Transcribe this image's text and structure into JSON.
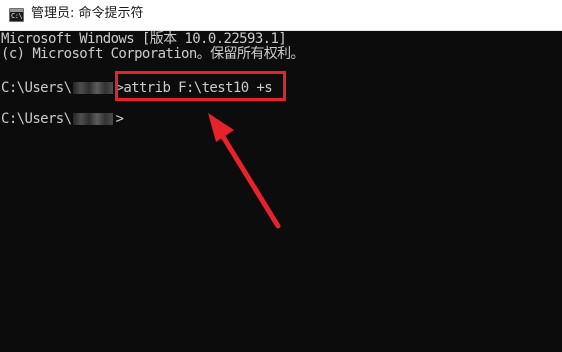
{
  "window": {
    "title": "管理员: 命令提示符",
    "icon": "cmd-icon",
    "icon_glyph": "C:\\"
  },
  "console": {
    "line1": "Microsoft Windows [版本 10.0.22593.1]",
    "line2": "(c) Microsoft Corporation。保留所有权利。",
    "prompt_prefix": "C:\\Users\\",
    "prompt_suffix": ">",
    "command": "attrib F:\\test10 +s",
    "prompt2_suffix": ">"
  },
  "colors": {
    "console_bg": "#0c0c0c",
    "console_text": "#cccccc",
    "highlight": "#e8222a",
    "titlebar_bg": "#ffffff"
  }
}
